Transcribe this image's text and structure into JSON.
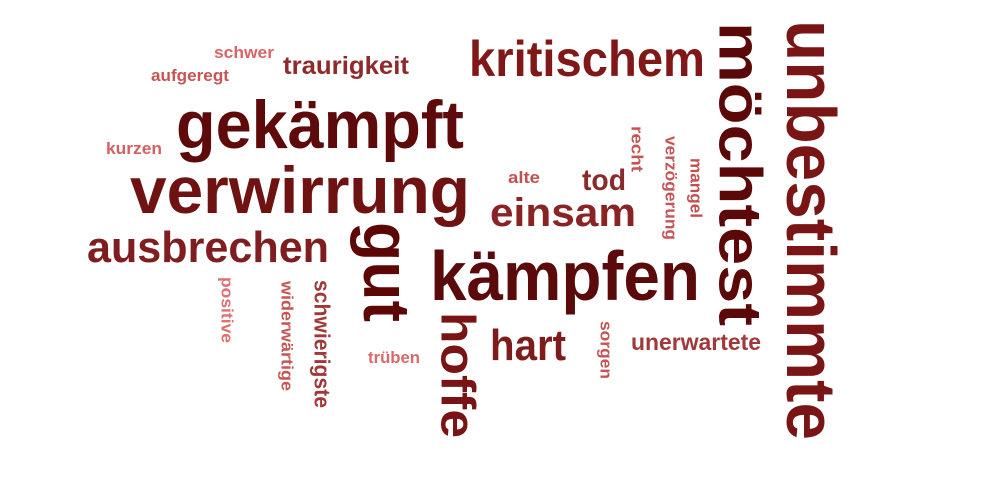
{
  "word_cloud": {
    "words": [
      {
        "text": "gekämpft",
        "color": "#5e0a0a"
      },
      {
        "text": "verwirrung",
        "color": "#6e1212"
      },
      {
        "text": "ausbrechen",
        "color": "#7e1e1e"
      },
      {
        "text": "kritischem",
        "color": "#801818"
      },
      {
        "text": "möchtest",
        "color": "#5a0808"
      },
      {
        "text": "unbestimmte",
        "color": "#7a1515"
      },
      {
        "text": "gut",
        "color": "#5c0606"
      },
      {
        "text": "kämpfen",
        "color": "#5a0a0a"
      },
      {
        "text": "hoffe",
        "color": "#7a1414"
      },
      {
        "text": "hart",
        "color": "#7e1c1c"
      },
      {
        "text": "einsam",
        "color": "#8a2424"
      },
      {
        "text": "tod",
        "color": "#8a2a2a"
      },
      {
        "text": "traurigkeit",
        "color": "#8e2a2a"
      },
      {
        "text": "unerwartete",
        "color": "#a03a3a"
      },
      {
        "text": "schwierigste",
        "color": "#a03838"
      },
      {
        "text": "alte",
        "color": "#c25050"
      },
      {
        "text": "recht",
        "color": "#c65454"
      },
      {
        "text": "verzögerung",
        "color": "#c65656"
      },
      {
        "text": "mangel",
        "color": "#c24e4e"
      },
      {
        "text": "sorgen",
        "color": "#c65454"
      },
      {
        "text": "widerwärtige",
        "color": "#c65656"
      },
      {
        "text": "trüben",
        "color": "#d86a6a"
      },
      {
        "text": "positive",
        "color": "#de7070"
      },
      {
        "text": "kurzen",
        "color": "#d46060"
      },
      {
        "text": "schwer",
        "color": "#d86666"
      },
      {
        "text": "aufgeregt",
        "color": "#c85454"
      }
    ]
  }
}
